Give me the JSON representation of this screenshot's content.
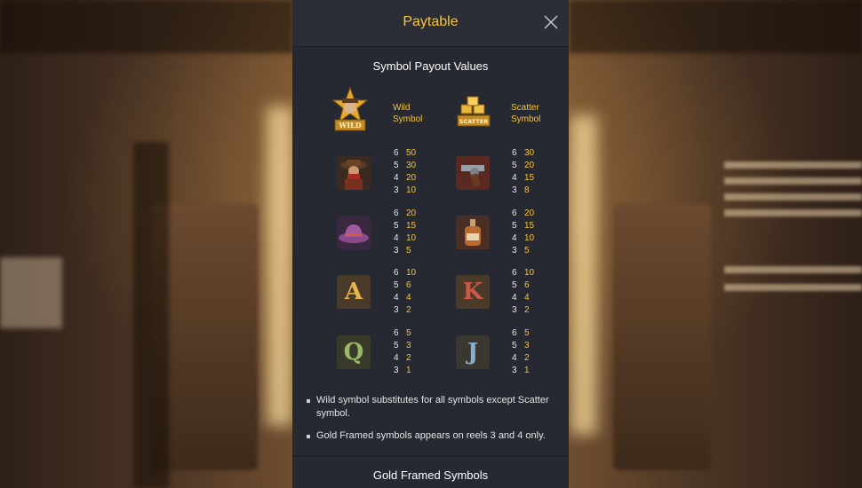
{
  "paytable": {
    "title": "Paytable",
    "section_title": "Symbol Payout Values",
    "wild": {
      "label_line1": "Wild",
      "label_line2": "Symbol",
      "badge": "WILD"
    },
    "scatter": {
      "label_line1": "Scatter",
      "label_line2": "Symbol",
      "badge": "SCATTER"
    },
    "symbols": [
      {
        "icon": "cowboy-icon",
        "payouts": [
          [
            "6",
            "50"
          ],
          [
            "5",
            "30"
          ],
          [
            "4",
            "20"
          ],
          [
            "3",
            "10"
          ]
        ]
      },
      {
        "icon": "revolver-icon",
        "payouts": [
          [
            "6",
            "30"
          ],
          [
            "5",
            "20"
          ],
          [
            "4",
            "15"
          ],
          [
            "3",
            "8"
          ]
        ]
      },
      {
        "icon": "cowboy-hat-icon",
        "payouts": [
          [
            "6",
            "20"
          ],
          [
            "5",
            "15"
          ],
          [
            "4",
            "10"
          ],
          [
            "3",
            "5"
          ]
        ]
      },
      {
        "icon": "whiskey-bottle-icon",
        "payouts": [
          [
            "6",
            "20"
          ],
          [
            "5",
            "15"
          ],
          [
            "4",
            "10"
          ],
          [
            "3",
            "5"
          ]
        ]
      },
      {
        "icon": "letter-a-icon",
        "letter": "A",
        "payouts": [
          [
            "6",
            "10"
          ],
          [
            "5",
            "6"
          ],
          [
            "4",
            "4"
          ],
          [
            "3",
            "2"
          ]
        ]
      },
      {
        "icon": "letter-k-icon",
        "letter": "K",
        "payouts": [
          [
            "6",
            "10"
          ],
          [
            "5",
            "6"
          ],
          [
            "4",
            "4"
          ],
          [
            "3",
            "2"
          ]
        ]
      },
      {
        "icon": "letter-q-icon",
        "letter": "Q",
        "payouts": [
          [
            "6",
            "5"
          ],
          [
            "5",
            "3"
          ],
          [
            "4",
            "2"
          ],
          [
            "3",
            "1"
          ]
        ]
      },
      {
        "icon": "letter-j-icon",
        "letter": "J",
        "payouts": [
          [
            "6",
            "5"
          ],
          [
            "5",
            "3"
          ],
          [
            "4",
            "2"
          ],
          [
            "3",
            "1"
          ]
        ]
      }
    ],
    "notes": [
      "Wild symbol substitutes for all symbols except Scatter symbol.",
      "Gold Framed symbols appears on reels 3 and 4 only."
    ],
    "footer_section_title": "Gold Framed Symbols",
    "colors": {
      "accent": "#f4c53d",
      "panel": "#262931",
      "header": "#2b2e37"
    }
  }
}
